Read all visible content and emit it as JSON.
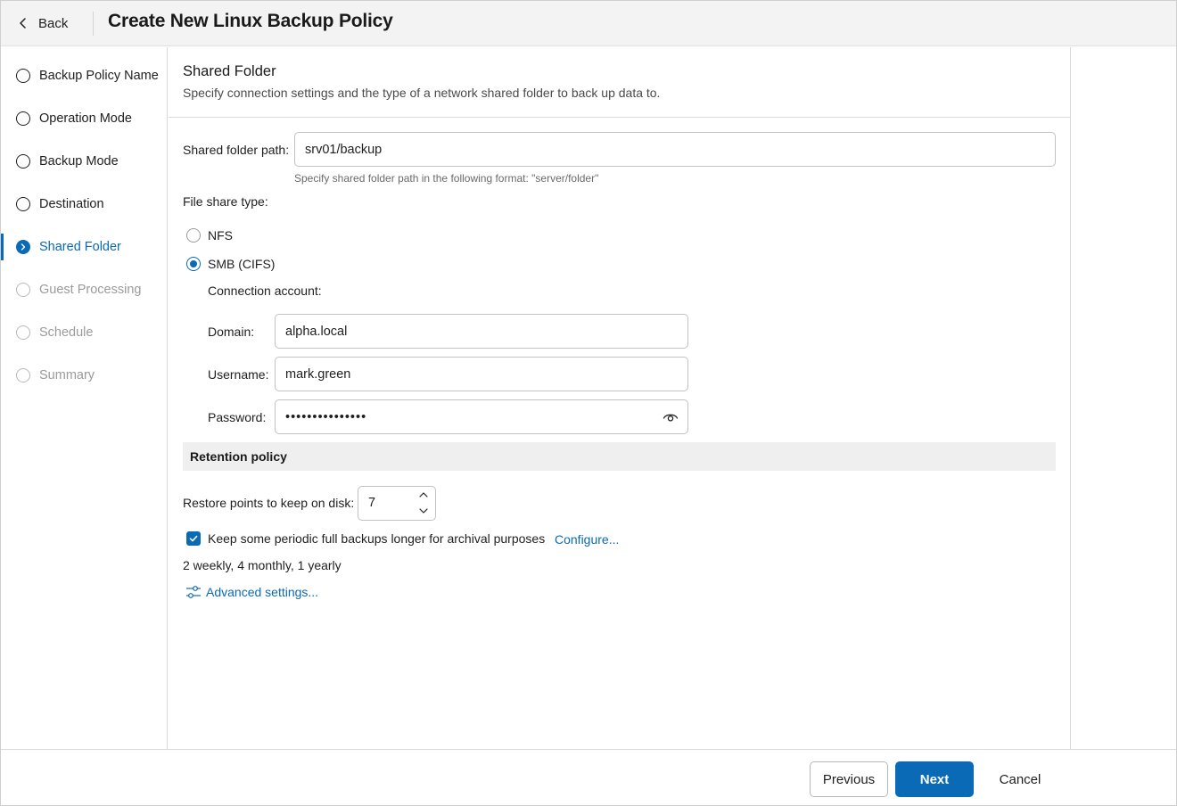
{
  "header": {
    "back_label": "Back",
    "title": "Create New Linux Backup Policy"
  },
  "sidebar": {
    "steps": [
      {
        "label": "Backup Policy Name",
        "state": "completed"
      },
      {
        "label": "Operation Mode",
        "state": "completed"
      },
      {
        "label": "Backup Mode",
        "state": "completed"
      },
      {
        "label": "Destination",
        "state": "completed"
      },
      {
        "label": "Shared Folder",
        "state": "active"
      },
      {
        "label": "Guest Processing",
        "state": "disabled"
      },
      {
        "label": "Schedule",
        "state": "disabled"
      },
      {
        "label": "Summary",
        "state": "disabled"
      }
    ]
  },
  "main": {
    "section_title": "Shared Folder",
    "section_description": "Specify connection settings and the type of a network shared folder to back up data to.",
    "shared_folder_path": {
      "label": "Shared folder path:",
      "value": "srv01/backup",
      "hint": "Specify shared folder path in the following format: \"server/folder\""
    },
    "file_share_type": {
      "label": "File share type:",
      "options": [
        {
          "label": "NFS",
          "selected": false
        },
        {
          "label": "SMB (CIFS)",
          "selected": true
        }
      ]
    },
    "connection_account": {
      "label": "Connection account:",
      "domain_label": "Domain:",
      "domain_value": "alpha.local",
      "username_label": "Username:",
      "username_value": "mark.green",
      "password_label": "Password:",
      "password_value": "•••••••••••••••"
    },
    "retention": {
      "title": "Retention policy",
      "restore_points_label": "Restore points to keep on disk:",
      "restore_points_value": "7",
      "archival_checkbox_label": "Keep some periodic full backups longer for archival purposes",
      "archival_checked": true,
      "configure_link": "Configure...",
      "archival_summary": "2 weekly, 4 monthly, 1 yearly",
      "advanced_link": "Advanced settings..."
    }
  },
  "footer": {
    "previous_label": "Previous",
    "next_label": "Next",
    "cancel_label": "Cancel"
  },
  "colors": {
    "accent": "#0a6ab5",
    "header_bg": "#f3f3f3",
    "retention_bg": "#efefef"
  },
  "icons": {
    "back": "chevron-left-icon",
    "active_step": "chevron-right-icon",
    "password_toggle": "eye-icon",
    "spinner_up": "chevron-up-icon",
    "spinner_down": "chevron-down-icon",
    "checkbox": "checkmark-icon",
    "advanced": "sliders-icon"
  }
}
